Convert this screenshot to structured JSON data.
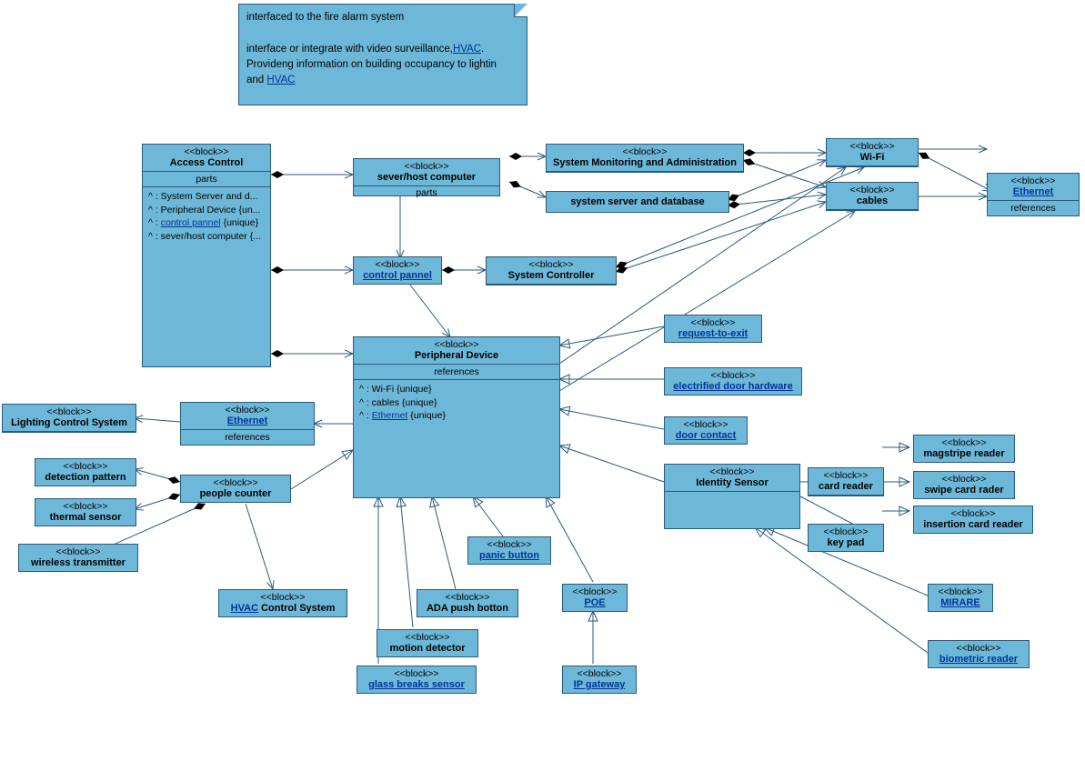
{
  "note": {
    "l1": "interfaced to the fire alarm system",
    "l2": "interface or integrate with video surveillance,",
    "l2link": "HVAC",
    "l2end": ".",
    "l3": "Provideng information on building occupancy to lightin",
    "l4a": "and ",
    "l4link": "HVAC"
  },
  "s": "<<block>>",
  "b": {
    "accessControl": "Access Control",
    "severHost": "sever/host computer",
    "sysMonAdmin": "System Monitoring and Administration",
    "wifi": "Wi-Fi",
    "ethernetR": "Ethernet",
    "sysServerDb": "system server and database",
    "cables": "cables",
    "controlPannel": "control pannel",
    "sysController": "System Controller",
    "peripheral": "Peripheral Device",
    "reqToExit": "request-to-exit",
    "elecDoorHw": "electrified door hardware",
    "ethernetL": "Ethernet",
    "lightingCtrl": "Lighting Control System",
    "doorContact": "door contact",
    "magstripe": "magstripe reader",
    "detection": "detection pattern",
    "peopleCounter": "people counter",
    "identitySensor": "Identity Sensor",
    "cardReader": "card reader",
    "swipeCard": "swipe card rader",
    "thermal": "thermal sensor",
    "keyPad": "key pad",
    "insertion": "insertion card reader",
    "wireless": "wireless transmitter",
    "panicBtn": "panic button",
    "hvacCtrl": " Control System",
    "hvacLink": "HVAC",
    "adaPush": "ADA push botton",
    "poe": "POE",
    "mirare": "MIRARE",
    "motion": "motion detector",
    "biometric": "biometric reader",
    "glassBreak": "glass breaks sensor",
    "ipGateway": "IP gateway"
  },
  "lbl": {
    "parts": "parts",
    "references": "references"
  },
  "ac": {
    "p1": "^  : System Server and d...",
    "p2": "^  : Peripheral Device {un...",
    "p3a": "^  : ",
    "p3link": "control pannel",
    "p3b": " {unique}",
    "p4": "^  : sever/host computer {..."
  },
  "pd": {
    "r1": "^  : Wi-Fi {unique}",
    "r2": "^  : cables {unique}",
    "r3a": "^  : ",
    "r3link": "Ethernet",
    "r3b": " {unique}"
  }
}
